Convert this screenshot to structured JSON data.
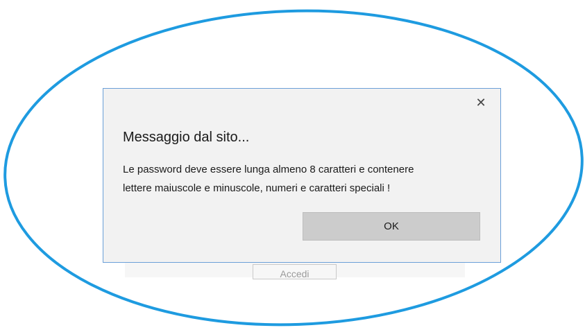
{
  "background_page": {
    "login_button_label": "Accedi"
  },
  "dialog": {
    "title": "Messaggio dal sito...",
    "message_line_1": "Le password deve essere lunga almeno 8 caratteri e contenere",
    "message_line_2": "lettere maiuscole e minuscole, numeri e caratteri speciali !",
    "ok_label": "OK",
    "close_glyph": "✕"
  },
  "colors": {
    "annotation_ellipse": "#1e9be0",
    "dialog_border": "#6a9fd8",
    "dialog_background": "#f2f2f2",
    "ok_button": "#cccccc"
  },
  "icons": {
    "close": "close-icon"
  }
}
